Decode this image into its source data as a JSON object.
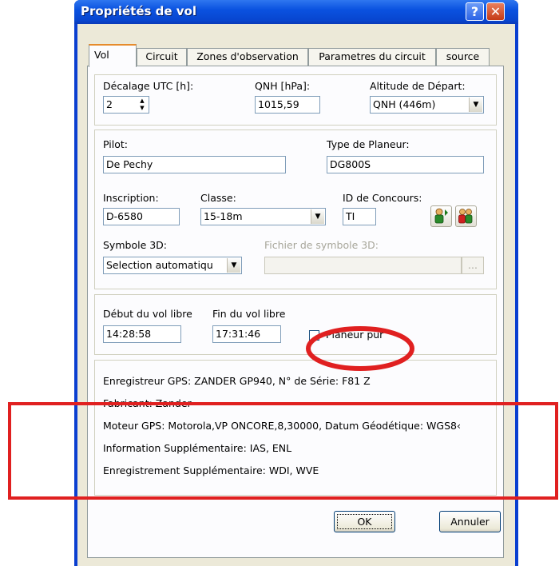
{
  "window": {
    "title": "Propriétés de vol",
    "help_label": "?",
    "close_label": "✕"
  },
  "tabs": [
    {
      "label": "Vol"
    },
    {
      "label": "Circuit"
    },
    {
      "label": "Zones d'observation"
    },
    {
      "label": "Parametres du circuit"
    },
    {
      "label": "source"
    }
  ],
  "timing": {
    "utc_offset_label": "Décalage UTC [h]:",
    "utc_offset_value": "2",
    "qnh_label": "QNH [hPa]:",
    "qnh_value": "1015,59",
    "start_alt_label": "Altitude de Départ:",
    "start_alt_value": "QNH (446m)"
  },
  "pilot": {
    "pilot_label": "Pilot:",
    "pilot_value": "De Pechy",
    "glider_type_label": "Type de Planeur:",
    "glider_type_value": "DG800S",
    "registration_label": "Inscription:",
    "registration_value": "D-6580",
    "class_label": "Classe:",
    "class_value": "15-18m",
    "contest_id_label": "ID de Concours:",
    "contest_id_value": "TI",
    "symbol_label": "Symbole 3D:",
    "symbol_value": "Selection automatiqu",
    "symbol_file_label": "Fichier de symbole 3D:",
    "browse_label": "..."
  },
  "free_flight": {
    "start_label": "Début du vol libre",
    "start_value": "14:28:58",
    "end_label": "Fin du vol libre",
    "end_value": "17:31:46",
    "pure_glider_label": "Planeur pur",
    "pure_glider_checked": false
  },
  "gps_info": {
    "recorder": "Enregistreur GPS: ZANDER GP940, N° de Série: F81 Z",
    "manufacturer": "Fabricant: Zander",
    "engine": "Moteur GPS: Motorola,VP ONCORE,8,30000, Datum Géodétique: WGS8‹",
    "extra_info": "Information Supplémentaire: IAS, ENL",
    "extra_record": "Enregistrement Supplémentaire: WDI, WVE"
  },
  "buttons": {
    "ok_label": "OK",
    "cancel_label": "Annuler"
  },
  "annotations": {
    "ellipse_color": "#e02020",
    "rect_color": "#e02020"
  }
}
